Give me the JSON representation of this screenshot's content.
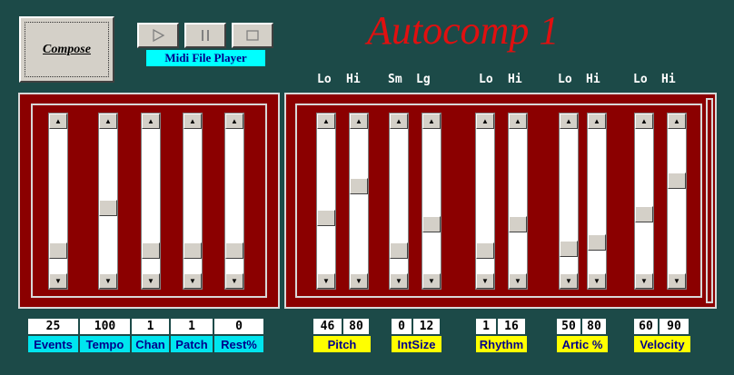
{
  "app": {
    "title": "Autocomp 1"
  },
  "compose": {
    "label": "Compose"
  },
  "player": {
    "caption": "Midi File Player",
    "buttons": [
      "play-icon",
      "pause-icon",
      "stop-icon"
    ]
  },
  "column_headers": {
    "pitch": [
      "Lo",
      "Hi"
    ],
    "intsize": [
      "Sm",
      "Lg"
    ],
    "rhythm": [
      "Lo",
      "Hi"
    ],
    "artic": [
      "Lo",
      "Hi"
    ],
    "velocity": [
      "Lo",
      "Hi"
    ]
  },
  "left_group": {
    "labels": [
      "Events",
      "Tempo",
      "Chan",
      "Patch",
      "Rest%"
    ],
    "values": [
      "25",
      "100",
      "1",
      "1",
      "0"
    ],
    "slider_positions": [
      0.89,
      0.55,
      0.89,
      0.89,
      0.89
    ]
  },
  "right_group": {
    "pitch": {
      "label": "Pitch",
      "values": [
        "46",
        "80"
      ],
      "slider_positions": [
        0.63,
        0.38
      ]
    },
    "intsize": {
      "label": "IntSize",
      "values": [
        "0",
        "12"
      ],
      "slider_positions": [
        0.89,
        0.68
      ]
    },
    "rhythm": {
      "label": "Rhythm",
      "values": [
        "1",
        "16"
      ],
      "slider_positions": [
        0.89,
        0.68
      ]
    },
    "artic": {
      "label": "Artic %",
      "values": [
        "50",
        "80"
      ],
      "slider_positions": [
        0.87,
        0.82
      ]
    },
    "velocity": {
      "label": "Velocity",
      "values": [
        "60",
        "90"
      ],
      "slider_positions": [
        0.6,
        0.34
      ]
    }
  },
  "colors": {
    "background": "#1c4a48",
    "panel": "#8b0000",
    "title": "#e01010",
    "left_label_bg": "#00e5ee",
    "right_label_bg": "#ffff00",
    "label_text": "#00008b"
  }
}
